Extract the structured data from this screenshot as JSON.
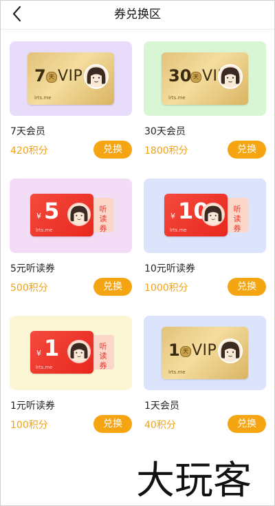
{
  "header": {
    "title": "券兑换区",
    "back_icon": "chevron-left-icon"
  },
  "colors": {
    "accent": "#f5a412",
    "points": "#f0a215"
  },
  "items": [
    {
      "name": "7天会员",
      "points": "420积分",
      "button": "兑换",
      "card": {
        "kind": "vip",
        "num": "7",
        "day": "天",
        "label": "VIP",
        "brand": "lrts.me",
        "bg": "#e7dcfa"
      }
    },
    {
      "name": "30天会员",
      "points": "1800积分",
      "button": "兑换",
      "card": {
        "kind": "vip",
        "num": "30",
        "day": "天",
        "label": "VIP",
        "brand": "lrts.me",
        "bg": "#d8f5d4"
      }
    },
    {
      "name": "5元听读券",
      "points": "500积分",
      "button": "兑换",
      "card": {
        "kind": "voucher",
        "yen": "¥",
        "num": "5",
        "tab": "听读券",
        "brand": "lrts.me",
        "bg": "#f3dcf6"
      }
    },
    {
      "name": "10元听读券",
      "points": "1000积分",
      "button": "兑换",
      "card": {
        "kind": "voucher",
        "yen": "¥",
        "num": "10",
        "tab": "听读券",
        "brand": "lrts.me",
        "bg": "#dbe4fb"
      }
    },
    {
      "name": "1元听读券",
      "points": "100积分",
      "button": "兑换",
      "card": {
        "kind": "voucher",
        "yen": "¥",
        "num": "1",
        "tab": "听读券",
        "brand": "lrts.me",
        "bg": "#fbf7d5"
      }
    },
    {
      "name": "1天会员",
      "points": "40积分",
      "button": "兑换",
      "card": {
        "kind": "vip",
        "num": "1",
        "day": "天",
        "label": "VIP",
        "brand": "lrts.me",
        "bg": "#dbe4fb"
      }
    }
  ],
  "watermark": {
    "text": "大玩客"
  }
}
